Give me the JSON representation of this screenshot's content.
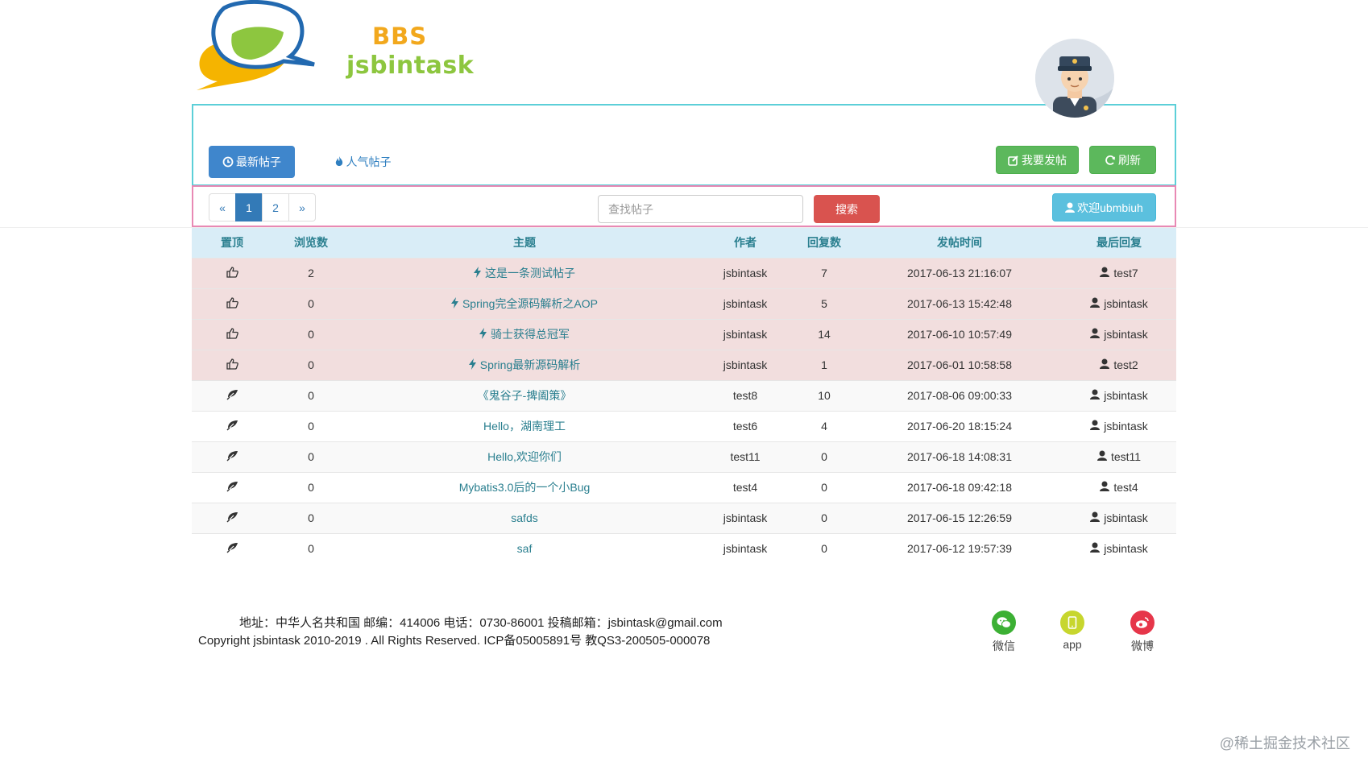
{
  "header": {
    "logo_text_top": "BBS",
    "logo_text_bottom": "jsbintask"
  },
  "tabs": {
    "newest": "最新帖子",
    "popular": "人气帖子"
  },
  "actions": {
    "post": "我要发帖",
    "refresh": "刷新"
  },
  "pagination": {
    "prev": "«",
    "pages": [
      "1",
      "2"
    ],
    "next": "»",
    "current": "1"
  },
  "search": {
    "placeholder": "查找帖子",
    "button": "搜索"
  },
  "welcome": "欢迎ubmbiuh",
  "table": {
    "headers": [
      "置顶",
      "浏览数",
      "主题",
      "作者",
      "回复数",
      "发帖时间",
      "最后回复"
    ],
    "rows": [
      {
        "pinned": true,
        "views": "2",
        "title": "这是一条测试帖子",
        "author": "jsbintask",
        "replies": "7",
        "time": "2017-06-13 21:16:07",
        "last": "test7"
      },
      {
        "pinned": true,
        "views": "0",
        "title": "Spring完全源码解析之AOP",
        "author": "jsbintask",
        "replies": "5",
        "time": "2017-06-13 15:42:48",
        "last": "jsbintask"
      },
      {
        "pinned": true,
        "views": "0",
        "title": "骑士获得总冠军",
        "author": "jsbintask",
        "replies": "14",
        "time": "2017-06-10 10:57:49",
        "last": "jsbintask"
      },
      {
        "pinned": true,
        "views": "0",
        "title": "Spring最新源码解析",
        "author": "jsbintask",
        "replies": "1",
        "time": "2017-06-01 10:58:58",
        "last": "test2"
      },
      {
        "pinned": false,
        "views": "0",
        "title": "《鬼谷子-捭阖策》",
        "author": "test8",
        "replies": "10",
        "time": "2017-08-06 09:00:33",
        "last": "jsbintask"
      },
      {
        "pinned": false,
        "views": "0",
        "title": "Hello，湖南理工",
        "author": "test6",
        "replies": "4",
        "time": "2017-06-20 18:15:24",
        "last": "jsbintask"
      },
      {
        "pinned": false,
        "views": "0",
        "title": "Hello,欢迎你们",
        "author": "test11",
        "replies": "0",
        "time": "2017-06-18 14:08:31",
        "last": "test11"
      },
      {
        "pinned": false,
        "views": "0",
        "title": "Mybatis3.0后的一个小Bug",
        "author": "test4",
        "replies": "0",
        "time": "2017-06-18 09:42:18",
        "last": "test4"
      },
      {
        "pinned": false,
        "views": "0",
        "title": "safds",
        "author": "jsbintask",
        "replies": "0",
        "time": "2017-06-15 12:26:59",
        "last": "jsbintask"
      },
      {
        "pinned": false,
        "views": "0",
        "title": "saf",
        "author": "jsbintask",
        "replies": "0",
        "time": "2017-06-12 19:57:39",
        "last": "jsbintask"
      }
    ]
  },
  "footer": {
    "address": "地址：中华人名共和国 邮编：414006 电话：0730-86001 投稿邮箱：jsbintask@gmail.com",
    "copyright": "Copyright jsbintask 2010-2019 . All Rights Reserved. ICP备05005891号 教QS3-200505-000078",
    "social": [
      {
        "label": "微信",
        "color": "#3cb034"
      },
      {
        "label": "app",
        "color": "#c7d62e"
      },
      {
        "label": "微博",
        "color": "#e6364a"
      }
    ]
  },
  "watermark": "@稀土掘金技术社区",
  "colors": {
    "primary": "#3f86cc",
    "success": "#5cb85c",
    "danger": "#d9534f",
    "info": "#5bc0de",
    "pinned_row": "#f2dede",
    "header_row": "#d9edf7"
  }
}
